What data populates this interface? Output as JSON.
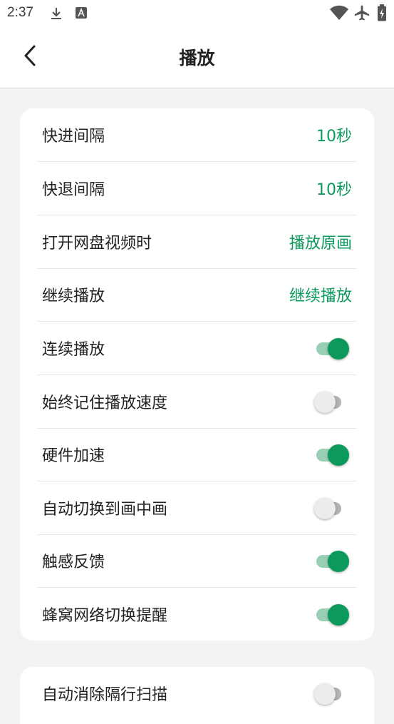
{
  "status_bar": {
    "time": "2:37",
    "icons": [
      "download-icon",
      "font-a-icon",
      "wifi-icon",
      "airplane-mode-icon",
      "battery-charging-icon"
    ]
  },
  "header": {
    "title": "播放",
    "back_icon": "chevron-left-icon"
  },
  "colors": {
    "accent": "#0c9a5c",
    "toggle_on_track": "#99cfb5",
    "toggle_off_track": "#b3b3b3",
    "background": "#f3f3f6"
  },
  "settings": {
    "fast_forward": {
      "label": "快进间隔",
      "value": "10秒"
    },
    "rewind": {
      "label": "快退间隔",
      "value": "10秒"
    },
    "open_video": {
      "label": "打开网盘视频时",
      "value": "播放原画"
    },
    "resume": {
      "label": "继续播放",
      "value": "继续播放"
    },
    "autoplay_next": {
      "label": "连续播放",
      "enabled": true
    },
    "remember_speed": {
      "label": "始终记住播放速度",
      "enabled": false
    },
    "hw_accel": {
      "label": "硬件加速",
      "enabled": true
    },
    "auto_pip": {
      "label": "自动切换到画中画",
      "enabled": false
    },
    "haptic": {
      "label": "触感反馈",
      "enabled": true
    },
    "cellular_alert": {
      "label": "蜂窝网络切换提醒",
      "enabled": true
    },
    "deinterlace": {
      "label": "自动消除隔行扫描",
      "enabled": false
    }
  }
}
